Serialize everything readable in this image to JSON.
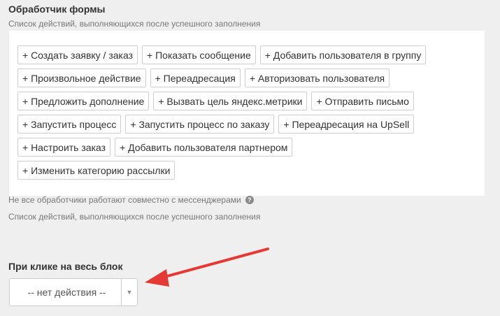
{
  "form_handler": {
    "title": "Обработчик формы",
    "hint": "Список действий, выполняющихся после успешного заполнения",
    "action_rows": [
      [
        "+ Создать заявку / заказ",
        "+ Показать сообщение",
        "+ Добавить пользователя в группу"
      ],
      [
        "+ Произвольное действие",
        "+ Переадресация",
        "+ Авторизовать пользователя"
      ],
      [
        "+ Предложить дополнение",
        "+ Вызвать цель яндекс.метрики",
        "+ Отправить письмо"
      ],
      [
        "+ Запустить процесс",
        "+ Запустить процесс по заказу",
        "+ Переадресация на UpSell"
      ],
      [
        "+ Настроить заказ",
        "+ Добавить пользователя партнером"
      ],
      [
        "+ Изменить категорию рассылки"
      ]
    ],
    "messenger_note": "Не все обработчики работают совместно с мессенджерами",
    "help_icon": "?",
    "hint_repeat": "Список действий, выполняющихся после успешного заполнения"
  },
  "block_click": {
    "title": "При клике на весь блок",
    "select_value": "-- нет действия --",
    "arrow_glyph": "▼"
  },
  "colors": {
    "annotation_arrow": "#e53935"
  },
  "icons": {
    "help": "question-circle-icon",
    "dropdown": "caret-down-icon",
    "annotation": "red-arrow-annotation"
  }
}
